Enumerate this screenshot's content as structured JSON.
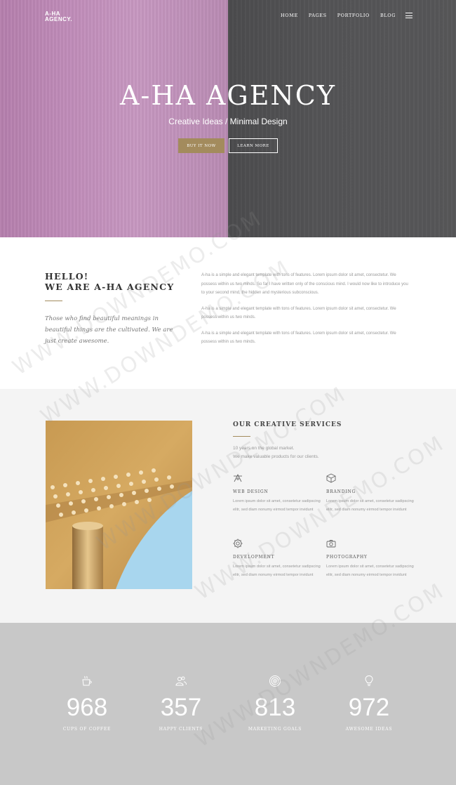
{
  "header": {
    "logo_line1": "A-HA",
    "logo_line2": "AGENCY.",
    "nav": [
      "HOME",
      "PAGES",
      "PORTFOLIO",
      "BLOG"
    ]
  },
  "hero": {
    "title": "A-HA AGENCY",
    "subtitle": "Creative Ideas / Minimal Design",
    "buy_label": "BUY IT NOW",
    "learn_label": "LEARN MORE",
    "colors": {
      "accent": "#a38b5d",
      "left_panel": "#c08cb9",
      "right_panel": "#555557"
    }
  },
  "about": {
    "heading_line1": "HELLO!",
    "heading_line2": "WE ARE A-HA AGENCY",
    "quote": "Those who find beautiful meanings in beautiful things are the cultivated. We are just create awesome.",
    "paragraphs": [
      "A-ha is a simple and elegant template with tons of features. Lorem ipsum dolor sit amet, consectetur. We possess within us two minds. So far I have written only of the conscious mind. I would now like to introduce you to your second mind, the hidden and mysterious subconscious.",
      "A-ha is a simple and elegant template with tons of features. Lorem ipsum dolor sit amet, consectetur. We possess within us two minds.",
      "A-ha is a simple and elegant template with tons of features. Lorem ipsum dolor sit amet, consectetur. We possess within us two minds."
    ]
  },
  "services": {
    "title": "OUR CREATIVE SERVICES",
    "intro_line1": "10 years on the global market.",
    "intro_line2": "We make valuable products for our clients.",
    "items": [
      {
        "icon": "pen-tool-icon",
        "name": "WEB DESIGN",
        "desc": "Lorem ipsum dolor sit amet, consetetur sadipscing elitr, sed diam nonumy eirmod tempor invidunt"
      },
      {
        "icon": "cube-icon",
        "name": "BRANDING",
        "desc": "Lorem ipsum dolor sit amet, consetetur sadipscing elitr, sed diam nonumy eirmod tempor invidunt"
      },
      {
        "icon": "gear-icon",
        "name": "DEVELOPMENT",
        "desc": "Lorem ipsum dolor sit amet, consetetur sadipscing elitr, sed diam nonumy eirmod tempor invidunt"
      },
      {
        "icon": "camera-icon",
        "name": "PHOTOGRAPHY",
        "desc": "Lorem ipsum dolor sit amet, consetetur sadipscing elitr, sed diam nonumy eirmod tempor invidunt"
      }
    ]
  },
  "stats": [
    {
      "icon": "coffee-cup-icon",
      "number": "968",
      "label": "CUPS OF COFFEE"
    },
    {
      "icon": "users-icon",
      "number": "357",
      "label": "HAPPY CLIENTS"
    },
    {
      "icon": "target-icon",
      "number": "813",
      "label": "MARKETING GOALS"
    },
    {
      "icon": "lightbulb-icon",
      "number": "972",
      "label": "AWESOME IDEAS"
    }
  ],
  "watermark": "WWW.DOWNDEMO.COM"
}
